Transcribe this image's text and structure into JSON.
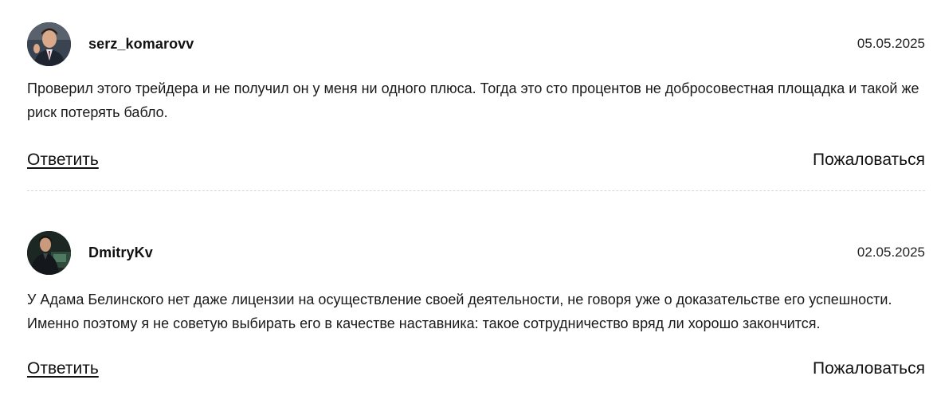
{
  "comments": [
    {
      "username": "serz_komarovv",
      "date": "05.05.2025",
      "text": "Проверил этого трейдера и не получил он у меня ни одного плюса. Тогда это сто процентов не добросовестная площадка и такой же риск потерять бабло.",
      "reply_label": "Ответить",
      "report_label": "Пожаловаться"
    },
    {
      "username": "DmitryKv",
      "date": "02.05.2025",
      "text": "У Адама Белинского нет даже лицензии на осуществление своей деятельности, не говоря уже о доказательстве его успешности. Именно поэтому я не советую выбирать его в качестве наставника: такое сотрудничество вряд ли хорошо закончится.",
      "reply_label": "Ответить",
      "report_label": "Пожаловаться"
    }
  ]
}
